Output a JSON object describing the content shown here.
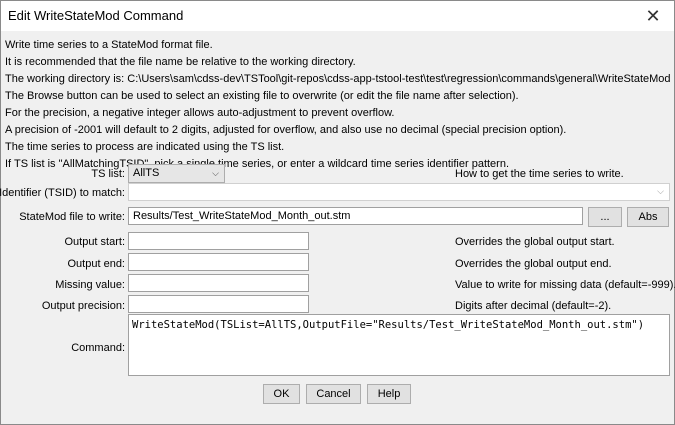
{
  "window": {
    "title": "Edit WriteStateMod Command",
    "close_glyph": "✕"
  },
  "info_lines": [
    "Write time series to a StateMod format file.",
    "It is recommended that the file name be relative to the working directory.",
    "The working directory is: C:\\Users\\sam\\cdss-dev\\TSTool\\git-repos\\cdss-app-tstool-test\\test\\regression\\commands\\general\\WriteStateMod",
    "The Browse button can be used to select an existing file to overwrite (or edit the file name after selection).",
    "For the precision, a negative integer allows auto-adjustment to prevent overflow.",
    "A precision of -2001 will default to 2 digits, adjusted for overflow, and also use no decimal (special precision option).",
    "The time series to process are indicated using the TS list.",
    "If TS list is \"AllMatchingTSID\", pick a single time series, or enter a wildcard time series identifier pattern."
  ],
  "form": {
    "ts_list": {
      "label": "TS list:",
      "value": "AllTS",
      "note": "How to get the time series to write."
    },
    "tsid": {
      "label": "Identifier (TSID) to match:",
      "value": ""
    },
    "statemod_file": {
      "label": "StateMod file to write:",
      "value": "Results/Test_WriteStateMod_Month_out.stm",
      "browse_label": "...",
      "abs_label": "Abs"
    },
    "output_start": {
      "label": "Output start:",
      "value": "",
      "note": "Overrides the global output start."
    },
    "output_end": {
      "label": "Output end:",
      "value": "",
      "note": "Overrides the global output end."
    },
    "missing_value": {
      "label": "Missing value:",
      "value": "",
      "note": "Value to write for missing data (default=-999)."
    },
    "output_precision": {
      "label": "Output precision:",
      "value": "",
      "note": "Digits after decimal (default=-2)."
    },
    "command": {
      "label": "Command:",
      "value": "WriteStateMod(TSList=AllTS,OutputFile=\"Results/Test_WriteStateMod_Month_out.stm\")"
    }
  },
  "buttons": {
    "ok": "OK",
    "cancel": "Cancel",
    "help": "Help"
  },
  "icons": {
    "dropdown": "chevron-down-icon",
    "close": "close-icon"
  }
}
